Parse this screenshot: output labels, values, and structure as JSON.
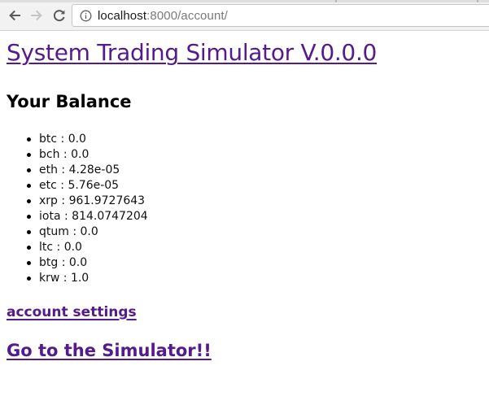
{
  "browser": {
    "url_host": "localhost",
    "url_rest": ":8000/account/"
  },
  "page": {
    "title": "System Trading Simulator V.0.0.0",
    "balance_heading": "Your Balance",
    "balances": [
      {
        "coin": "btc",
        "amount": "0.0"
      },
      {
        "coin": "bch",
        "amount": "0.0"
      },
      {
        "coin": "eth",
        "amount": "4.28e-05"
      },
      {
        "coin": "etc",
        "amount": "5.76e-05"
      },
      {
        "coin": "xrp",
        "amount": "961.9727643"
      },
      {
        "coin": "iota",
        "amount": "814.0747204"
      },
      {
        "coin": "qtum",
        "amount": "0.0"
      },
      {
        "coin": "ltc",
        "amount": "0.0"
      },
      {
        "coin": "btg",
        "amount": "0.0"
      },
      {
        "coin": "krw",
        "amount": "1.0"
      }
    ],
    "separator": " : ",
    "settings_link": "account settings",
    "simulator_link": "Go to the Simulator!!"
  },
  "colors": {
    "visited_link": "#551a8b",
    "toolbar_bg": "#f2f2f2"
  },
  "icons": {
    "back": "arrow-left-icon",
    "forward": "arrow-right-icon",
    "reload": "reload-icon",
    "site_info": "info-circle-icon"
  }
}
